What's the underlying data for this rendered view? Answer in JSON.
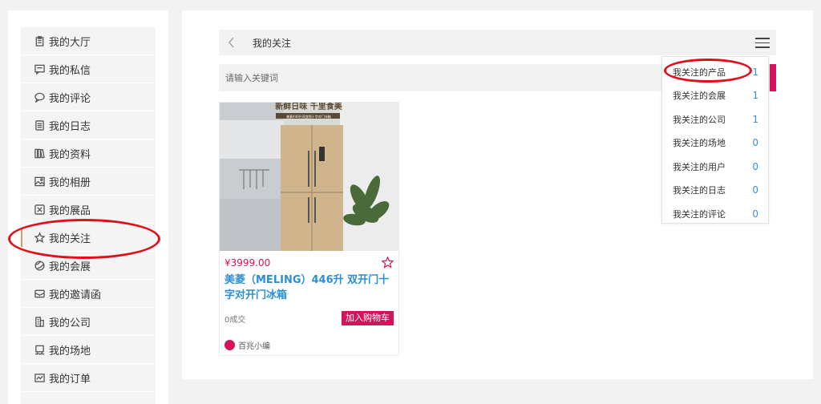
{
  "sidebar": {
    "items": [
      {
        "label": "我的大厅",
        "icon": "clipboard-icon"
      },
      {
        "label": "我的私信",
        "icon": "message-icon"
      },
      {
        "label": "我的评论",
        "icon": "comment-icon"
      },
      {
        "label": "我的日志",
        "icon": "log-icon"
      },
      {
        "label": "我的资料",
        "icon": "books-icon"
      },
      {
        "label": "我的相册",
        "icon": "image-icon"
      },
      {
        "label": "我的展品",
        "icon": "exhibit-icon"
      },
      {
        "label": "我的关注",
        "icon": "star-icon"
      },
      {
        "label": "我的会展",
        "icon": "globe-icon"
      },
      {
        "label": "我的邀请函",
        "icon": "envelope-icon"
      },
      {
        "label": "我的公司",
        "icon": "building-icon"
      },
      {
        "label": "我的场地",
        "icon": "venue-icon"
      },
      {
        "label": "我的订单",
        "icon": "order-icon"
      }
    ]
  },
  "header": {
    "title": "我的关注"
  },
  "search": {
    "placeholder": "请输入关键词"
  },
  "dropdown": {
    "items": [
      {
        "label": "我关注的产品",
        "count": "1"
      },
      {
        "label": "我关注的会展",
        "count": "1"
      },
      {
        "label": "我关注的公司",
        "count": "1"
      },
      {
        "label": "我关注的场地",
        "count": "0"
      },
      {
        "label": "我关注的用户",
        "count": "0"
      },
      {
        "label": "我关注的日志",
        "count": "0"
      },
      {
        "label": "我关注的评论",
        "count": "0"
      }
    ]
  },
  "product": {
    "price": "¥3999.00",
    "name": "美菱（MELING）446升 双开门十字对开门冰箱",
    "sold": "0成交",
    "cart_label": "加入购物车",
    "shop_name": "百兆小编",
    "banner_title": "新鲜日味 千里食美",
    "banner_sub": "美菱446升双变频十字对门冰箱"
  },
  "colors": {
    "accent": "#d4145a",
    "link": "#2a8fd4",
    "count": "#3b8fd9",
    "annotation": "#e0101a"
  }
}
